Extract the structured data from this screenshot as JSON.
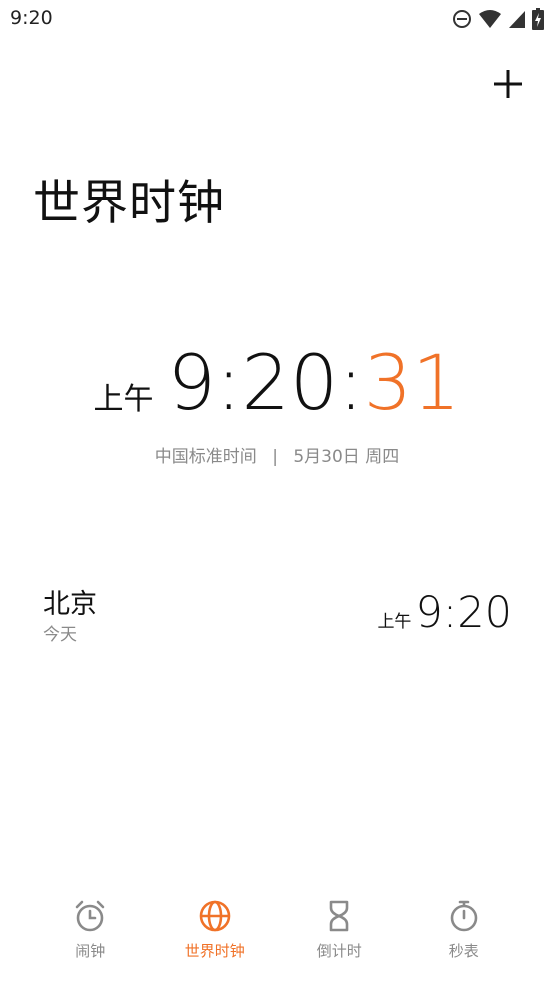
{
  "status_bar": {
    "time": "9:20",
    "icons": [
      "do-not-disturb-icon",
      "wifi-icon",
      "signal-icon",
      "battery-charging-icon"
    ]
  },
  "header": {
    "add_icon": "plus-icon"
  },
  "page": {
    "title": "世界时钟"
  },
  "local_clock": {
    "ampm": "上午",
    "hour_minute": "9:20:",
    "seconds": "31",
    "timezone": "中国标准时间",
    "separator": "|",
    "date": "5月30日 周四",
    "accent_color": "#f07228"
  },
  "cities": [
    {
      "name": "北京",
      "day": "今天",
      "ampm": "上午",
      "time": "9:20"
    }
  ],
  "bottom_nav": {
    "items": [
      {
        "label": "闹钟",
        "icon": "alarm-clock-icon",
        "active": false
      },
      {
        "label": "世界时钟",
        "icon": "globe-icon",
        "active": true
      },
      {
        "label": "倒计时",
        "icon": "hourglass-icon",
        "active": false
      },
      {
        "label": "秒表",
        "icon": "stopwatch-icon",
        "active": false
      }
    ]
  }
}
